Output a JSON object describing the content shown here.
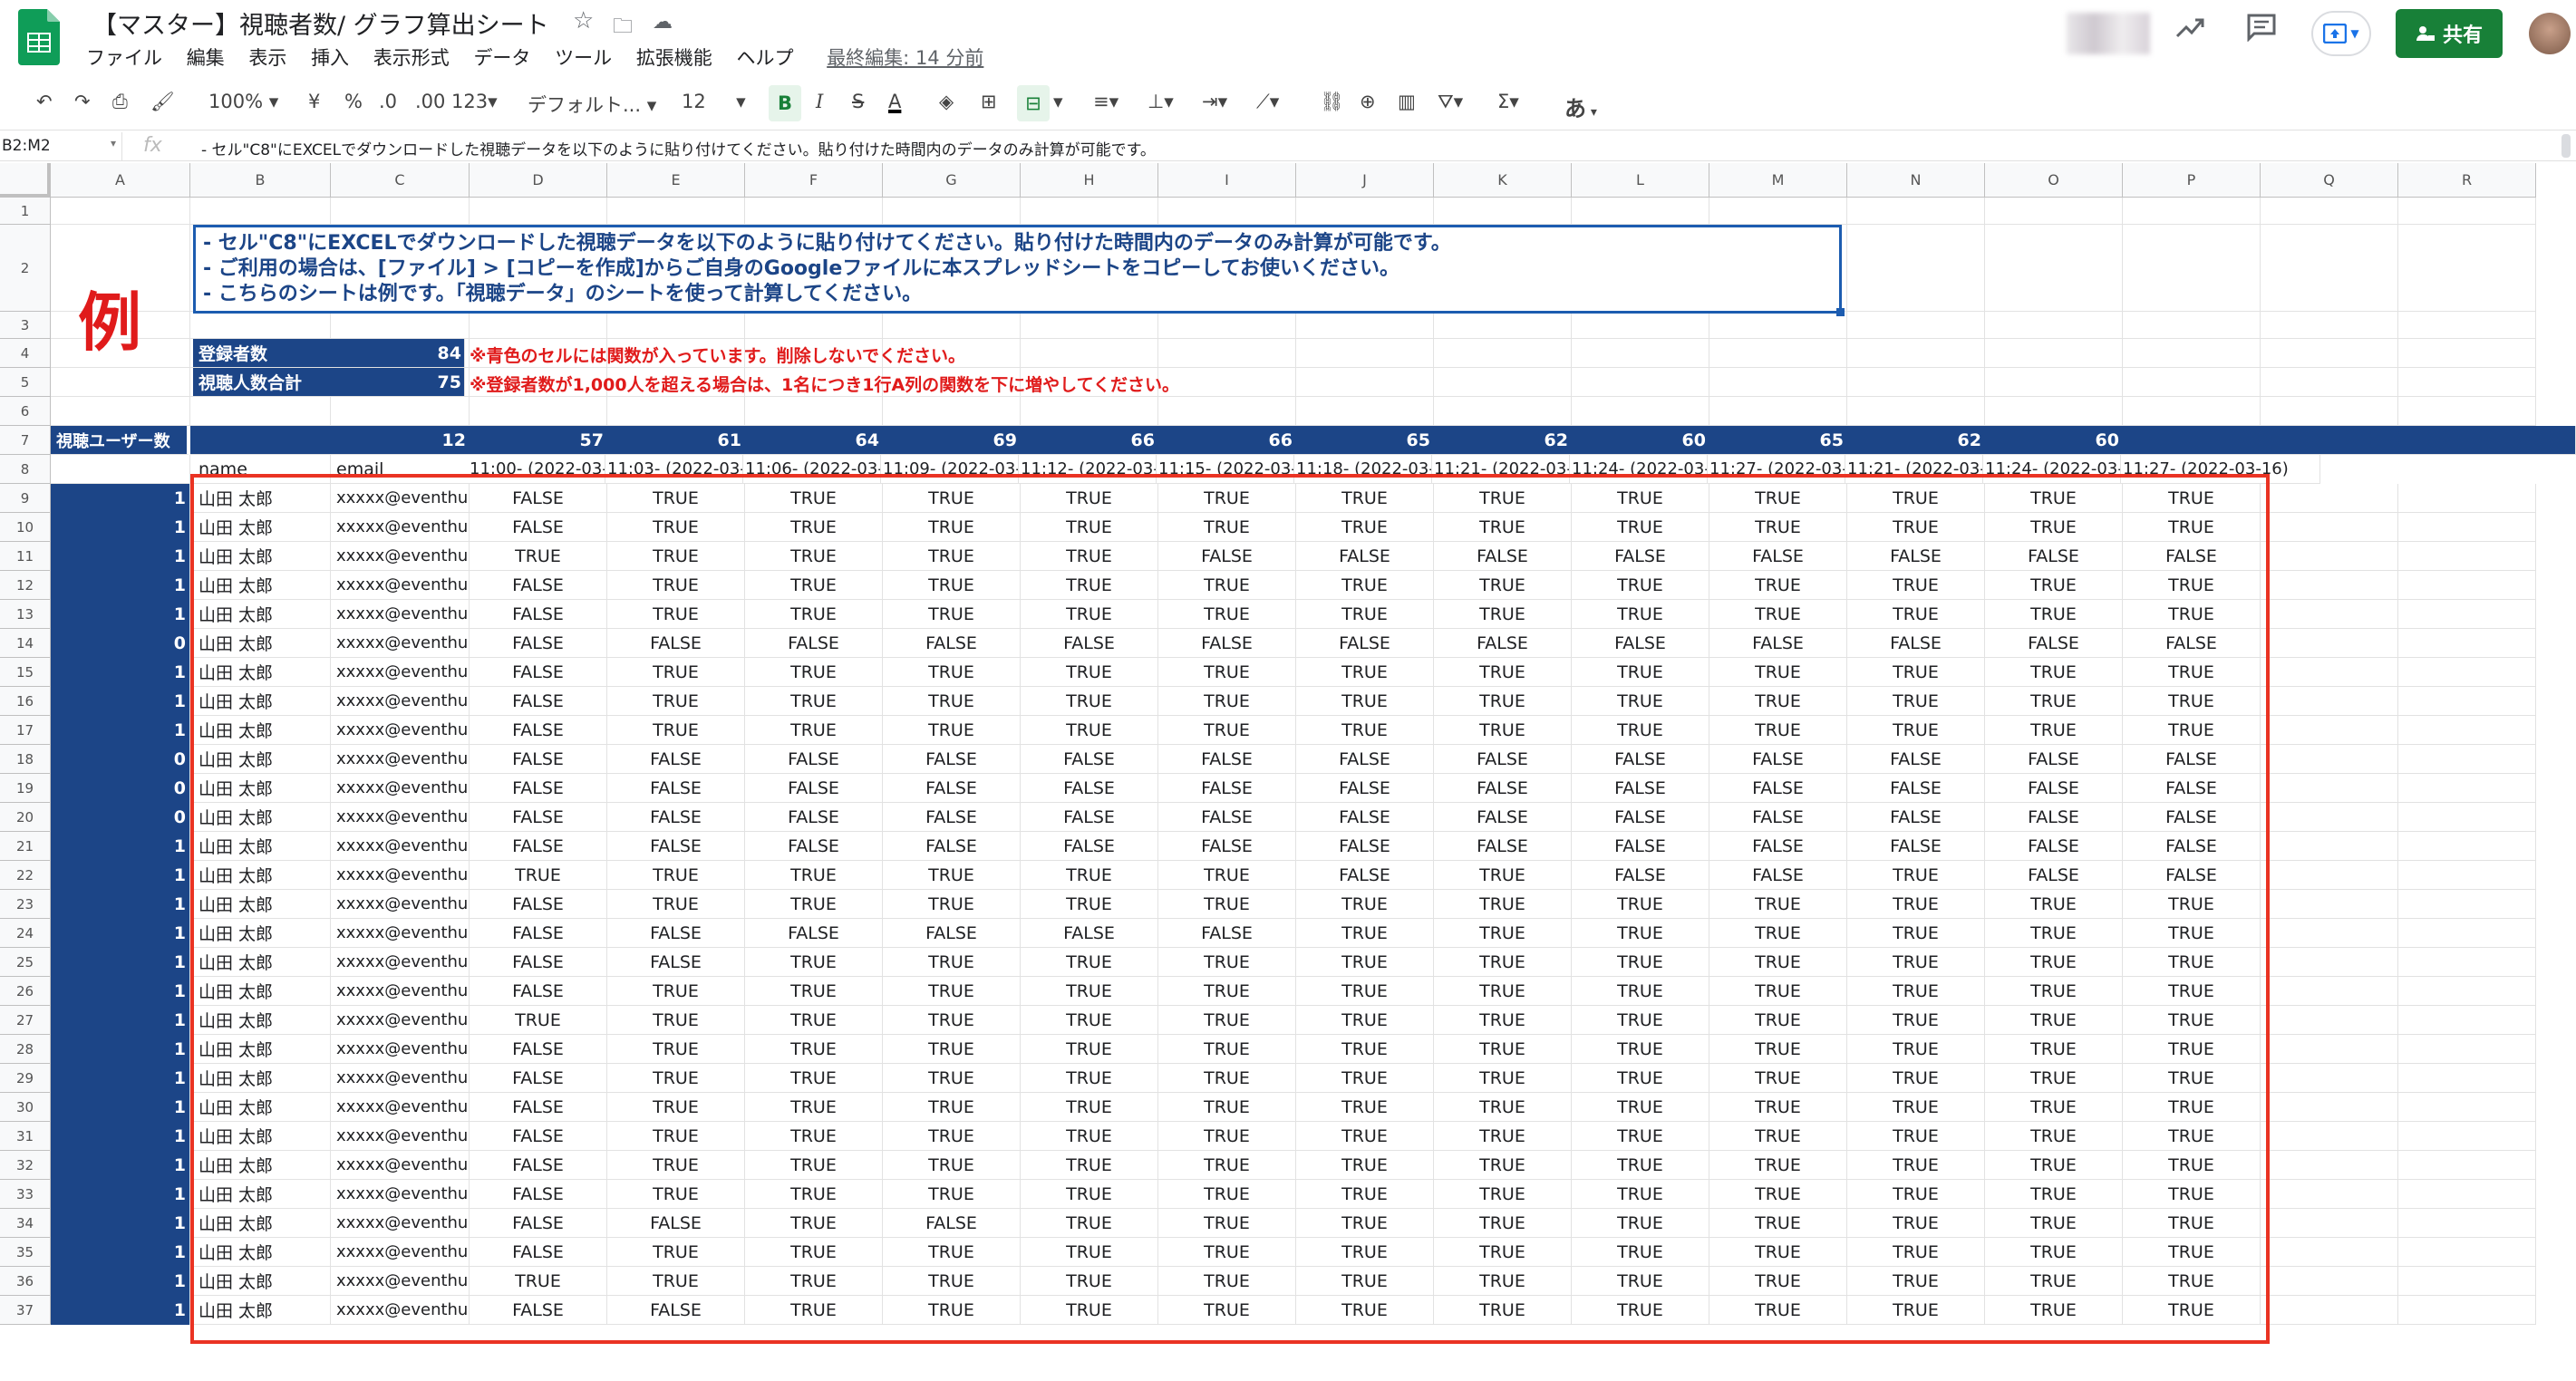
{
  "app": {
    "doc_title": "【マスター】視聴者数/ グラフ算出シート",
    "menus": [
      "ファイル",
      "編集",
      "表示",
      "挿入",
      "表示形式",
      "データ",
      "ツール",
      "拡張機能",
      "ヘルプ"
    ],
    "last_edit": "最終編集: 14 分前",
    "share_label": "共有"
  },
  "toolbar": {
    "zoom": "100%",
    "currency": "¥",
    "percent": "%",
    "dec_less": ".0",
    "dec_more": ".00",
    "format_more": "123",
    "font": "デフォルト...",
    "font_size": "12",
    "input_tool": "あ"
  },
  "formula_bar": {
    "name_box": "B2:M2",
    "fx": "fx",
    "content": "- セル\"C8\"にEXCELでダウンロードした視聴データを以下のように貼り付けてください。貼り付けた時間内のデータのみ計算が可能です。"
  },
  "columns": [
    "A",
    "B",
    "C",
    "D",
    "E",
    "F",
    "G",
    "H",
    "I",
    "J",
    "K",
    "L",
    "M",
    "N",
    "O",
    "P",
    "Q",
    "R"
  ],
  "rows": [
    "1",
    "2",
    "3",
    "4",
    "5",
    "6",
    "7",
    "8",
    "9",
    "10",
    "11",
    "12",
    "13",
    "14",
    "15",
    "16",
    "17",
    "18",
    "19",
    "20",
    "21",
    "22",
    "23",
    "24",
    "25",
    "26",
    "27",
    "28",
    "29",
    "30",
    "31",
    "32",
    "33",
    "34",
    "35",
    "36",
    "37"
  ],
  "sheet": {
    "example_label": "例",
    "note_lines": [
      "- セル\"C8\"にEXCELでダウンロードした視聴データを以下のように貼り付けてください。貼り付けた時間内のデータのみ計算が可能です。",
      "- ご利用の場合は、[ファイル] > [コピーを作成]からご自身のGoogleファイルに本スプレッドシートをコピーしてお使いください。",
      "- こちらのシートは例です。「視聴データ」のシートを使って計算してください。"
    ],
    "registered_label": "登録者数",
    "registered_value": "84",
    "viewers_label": "視聴人数合計",
    "viewers_value": "75",
    "warning1": "※青色のセルには関数が入っています。削除しないでください。",
    "warning2": "※登録者数が1,000人を超える場合は、1名につき1行A列の関数を下に増やしてください。",
    "row7_label": "視聴ユーザー数",
    "counts": [
      "12",
      "57",
      "61",
      "64",
      "69",
      "66",
      "66",
      "65",
      "62",
      "60",
      "65",
      "62",
      "60"
    ],
    "header_name": "name",
    "header_email": "email",
    "time_headers": [
      "11:00- (2022-03-",
      "11:03- (2022-03-",
      "11:06- (2022-03-",
      "11:09- (2022-03-",
      "11:12- (2022-03-",
      "11:15- (2022-03-",
      "11:18- (2022-03-",
      "11:21- (2022-03-",
      "11:24- (2022-03-",
      "11:27- (2022-03-",
      "11:21- (2022-03-",
      "11:24- (2022-03-",
      "11:27- (2022-03-16)"
    ],
    "data_rows": [
      {
        "a": "1",
        "name": "山田 太郎",
        "email": "xxxxx@eventhu",
        "v": [
          "FALSE",
          "TRUE",
          "TRUE",
          "TRUE",
          "TRUE",
          "TRUE",
          "TRUE",
          "TRUE",
          "TRUE",
          "TRUE",
          "TRUE",
          "TRUE",
          "TRUE"
        ]
      },
      {
        "a": "1",
        "name": "山田 太郎",
        "email": "xxxxx@eventhu",
        "v": [
          "FALSE",
          "TRUE",
          "TRUE",
          "TRUE",
          "TRUE",
          "TRUE",
          "TRUE",
          "TRUE",
          "TRUE",
          "TRUE",
          "TRUE",
          "TRUE",
          "TRUE"
        ]
      },
      {
        "a": "1",
        "name": "山田 太郎",
        "email": "xxxxx@eventhu",
        "v": [
          "TRUE",
          "TRUE",
          "TRUE",
          "TRUE",
          "TRUE",
          "FALSE",
          "FALSE",
          "FALSE",
          "FALSE",
          "FALSE",
          "FALSE",
          "FALSE",
          "FALSE"
        ]
      },
      {
        "a": "1",
        "name": "山田 太郎",
        "email": "xxxxx@eventhu",
        "v": [
          "FALSE",
          "TRUE",
          "TRUE",
          "TRUE",
          "TRUE",
          "TRUE",
          "TRUE",
          "TRUE",
          "TRUE",
          "TRUE",
          "TRUE",
          "TRUE",
          "TRUE"
        ]
      },
      {
        "a": "1",
        "name": "山田 太郎",
        "email": "xxxxx@eventhu",
        "v": [
          "FALSE",
          "TRUE",
          "TRUE",
          "TRUE",
          "TRUE",
          "TRUE",
          "TRUE",
          "TRUE",
          "TRUE",
          "TRUE",
          "TRUE",
          "TRUE",
          "TRUE"
        ]
      },
      {
        "a": "0",
        "name": "山田 太郎",
        "email": "xxxxx@eventhu",
        "v": [
          "FALSE",
          "FALSE",
          "FALSE",
          "FALSE",
          "FALSE",
          "FALSE",
          "FALSE",
          "FALSE",
          "FALSE",
          "FALSE",
          "FALSE",
          "FALSE",
          "FALSE"
        ]
      },
      {
        "a": "1",
        "name": "山田 太郎",
        "email": "xxxxx@eventhu",
        "v": [
          "FALSE",
          "TRUE",
          "TRUE",
          "TRUE",
          "TRUE",
          "TRUE",
          "TRUE",
          "TRUE",
          "TRUE",
          "TRUE",
          "TRUE",
          "TRUE",
          "TRUE"
        ]
      },
      {
        "a": "1",
        "name": "山田 太郎",
        "email": "xxxxx@eventhu",
        "v": [
          "FALSE",
          "TRUE",
          "TRUE",
          "TRUE",
          "TRUE",
          "TRUE",
          "TRUE",
          "TRUE",
          "TRUE",
          "TRUE",
          "TRUE",
          "TRUE",
          "TRUE"
        ]
      },
      {
        "a": "1",
        "name": "山田 太郎",
        "email": "xxxxx@eventhu",
        "v": [
          "FALSE",
          "TRUE",
          "TRUE",
          "TRUE",
          "TRUE",
          "TRUE",
          "TRUE",
          "TRUE",
          "TRUE",
          "TRUE",
          "TRUE",
          "TRUE",
          "TRUE"
        ]
      },
      {
        "a": "0",
        "name": "山田 太郎",
        "email": "xxxxx@eventhu",
        "v": [
          "FALSE",
          "FALSE",
          "FALSE",
          "FALSE",
          "FALSE",
          "FALSE",
          "FALSE",
          "FALSE",
          "FALSE",
          "FALSE",
          "FALSE",
          "FALSE",
          "FALSE"
        ]
      },
      {
        "a": "0",
        "name": "山田 太郎",
        "email": "xxxxx@eventhu",
        "v": [
          "FALSE",
          "FALSE",
          "FALSE",
          "FALSE",
          "FALSE",
          "FALSE",
          "FALSE",
          "FALSE",
          "FALSE",
          "FALSE",
          "FALSE",
          "FALSE",
          "FALSE"
        ]
      },
      {
        "a": "0",
        "name": "山田 太郎",
        "email": "xxxxx@eventhu",
        "v": [
          "FALSE",
          "FALSE",
          "FALSE",
          "FALSE",
          "FALSE",
          "FALSE",
          "FALSE",
          "FALSE",
          "FALSE",
          "FALSE",
          "FALSE",
          "FALSE",
          "FALSE"
        ]
      },
      {
        "a": "1",
        "name": "山田 太郎",
        "email": "xxxxx@eventhu",
        "v": [
          "FALSE",
          "FALSE",
          "FALSE",
          "FALSE",
          "FALSE",
          "FALSE",
          "FALSE",
          "FALSE",
          "FALSE",
          "FALSE",
          "FALSE",
          "FALSE",
          "FALSE"
        ]
      },
      {
        "a": "1",
        "name": "山田 太郎",
        "email": "xxxxx@eventhu",
        "v": [
          "TRUE",
          "TRUE",
          "TRUE",
          "TRUE",
          "TRUE",
          "TRUE",
          "FALSE",
          "TRUE",
          "FALSE",
          "FALSE",
          "TRUE",
          "FALSE",
          "FALSE"
        ]
      },
      {
        "a": "1",
        "name": "山田 太郎",
        "email": "xxxxx@eventhu",
        "v": [
          "FALSE",
          "TRUE",
          "TRUE",
          "TRUE",
          "TRUE",
          "TRUE",
          "TRUE",
          "TRUE",
          "TRUE",
          "TRUE",
          "TRUE",
          "TRUE",
          "TRUE"
        ]
      },
      {
        "a": "1",
        "name": "山田 太郎",
        "email": "xxxxx@eventhu",
        "v": [
          "FALSE",
          "FALSE",
          "FALSE",
          "FALSE",
          "FALSE",
          "FALSE",
          "TRUE",
          "TRUE",
          "TRUE",
          "TRUE",
          "TRUE",
          "TRUE",
          "TRUE"
        ]
      },
      {
        "a": "1",
        "name": "山田 太郎",
        "email": "xxxxx@eventhu",
        "v": [
          "FALSE",
          "FALSE",
          "TRUE",
          "TRUE",
          "TRUE",
          "TRUE",
          "TRUE",
          "TRUE",
          "TRUE",
          "TRUE",
          "TRUE",
          "TRUE",
          "TRUE"
        ]
      },
      {
        "a": "1",
        "name": "山田 太郎",
        "email": "xxxxx@eventhu",
        "v": [
          "FALSE",
          "TRUE",
          "TRUE",
          "TRUE",
          "TRUE",
          "TRUE",
          "TRUE",
          "TRUE",
          "TRUE",
          "TRUE",
          "TRUE",
          "TRUE",
          "TRUE"
        ]
      },
      {
        "a": "1",
        "name": "山田 太郎",
        "email": "xxxxx@eventhu",
        "v": [
          "TRUE",
          "TRUE",
          "TRUE",
          "TRUE",
          "TRUE",
          "TRUE",
          "TRUE",
          "TRUE",
          "TRUE",
          "TRUE",
          "TRUE",
          "TRUE",
          "TRUE"
        ]
      },
      {
        "a": "1",
        "name": "山田 太郎",
        "email": "xxxxx@eventhu",
        "v": [
          "FALSE",
          "TRUE",
          "TRUE",
          "TRUE",
          "TRUE",
          "TRUE",
          "TRUE",
          "TRUE",
          "TRUE",
          "TRUE",
          "TRUE",
          "TRUE",
          "TRUE"
        ]
      },
      {
        "a": "1",
        "name": "山田 太郎",
        "email": "xxxxx@eventhu",
        "v": [
          "FALSE",
          "TRUE",
          "TRUE",
          "TRUE",
          "TRUE",
          "TRUE",
          "TRUE",
          "TRUE",
          "TRUE",
          "TRUE",
          "TRUE",
          "TRUE",
          "TRUE"
        ]
      },
      {
        "a": "1",
        "name": "山田 太郎",
        "email": "xxxxx@eventhu",
        "v": [
          "FALSE",
          "TRUE",
          "TRUE",
          "TRUE",
          "TRUE",
          "TRUE",
          "TRUE",
          "TRUE",
          "TRUE",
          "TRUE",
          "TRUE",
          "TRUE",
          "TRUE"
        ]
      },
      {
        "a": "1",
        "name": "山田 太郎",
        "email": "xxxxx@eventhu",
        "v": [
          "FALSE",
          "TRUE",
          "TRUE",
          "TRUE",
          "TRUE",
          "TRUE",
          "TRUE",
          "TRUE",
          "TRUE",
          "TRUE",
          "TRUE",
          "TRUE",
          "TRUE"
        ]
      },
      {
        "a": "1",
        "name": "山田 太郎",
        "email": "xxxxx@eventhu",
        "v": [
          "FALSE",
          "TRUE",
          "TRUE",
          "TRUE",
          "TRUE",
          "TRUE",
          "TRUE",
          "TRUE",
          "TRUE",
          "TRUE",
          "TRUE",
          "TRUE",
          "TRUE"
        ]
      },
      {
        "a": "1",
        "name": "山田 太郎",
        "email": "xxxxx@eventhu",
        "v": [
          "FALSE",
          "TRUE",
          "TRUE",
          "TRUE",
          "TRUE",
          "TRUE",
          "TRUE",
          "TRUE",
          "TRUE",
          "TRUE",
          "TRUE",
          "TRUE",
          "TRUE"
        ]
      },
      {
        "a": "1",
        "name": "山田 太郎",
        "email": "xxxxx@eventhu",
        "v": [
          "FALSE",
          "FALSE",
          "TRUE",
          "FALSE",
          "TRUE",
          "TRUE",
          "TRUE",
          "TRUE",
          "TRUE",
          "TRUE",
          "TRUE",
          "TRUE",
          "TRUE"
        ]
      },
      {
        "a": "1",
        "name": "山田 太郎",
        "email": "xxxxx@eventhu",
        "v": [
          "FALSE",
          "TRUE",
          "TRUE",
          "TRUE",
          "TRUE",
          "TRUE",
          "TRUE",
          "TRUE",
          "TRUE",
          "TRUE",
          "TRUE",
          "TRUE",
          "TRUE"
        ]
      },
      {
        "a": "1",
        "name": "山田 太郎",
        "email": "xxxxx@eventhu",
        "v": [
          "TRUE",
          "TRUE",
          "TRUE",
          "TRUE",
          "TRUE",
          "TRUE",
          "TRUE",
          "TRUE",
          "TRUE",
          "TRUE",
          "TRUE",
          "TRUE",
          "TRUE"
        ]
      },
      {
        "a": "1",
        "name": "山田 太郎",
        "email": "xxxxx@eventhu",
        "v": [
          "FALSE",
          "FALSE",
          "TRUE",
          "TRUE",
          "TRUE",
          "TRUE",
          "TRUE",
          "TRUE",
          "TRUE",
          "TRUE",
          "TRUE",
          "TRUE",
          "TRUE"
        ]
      }
    ]
  }
}
